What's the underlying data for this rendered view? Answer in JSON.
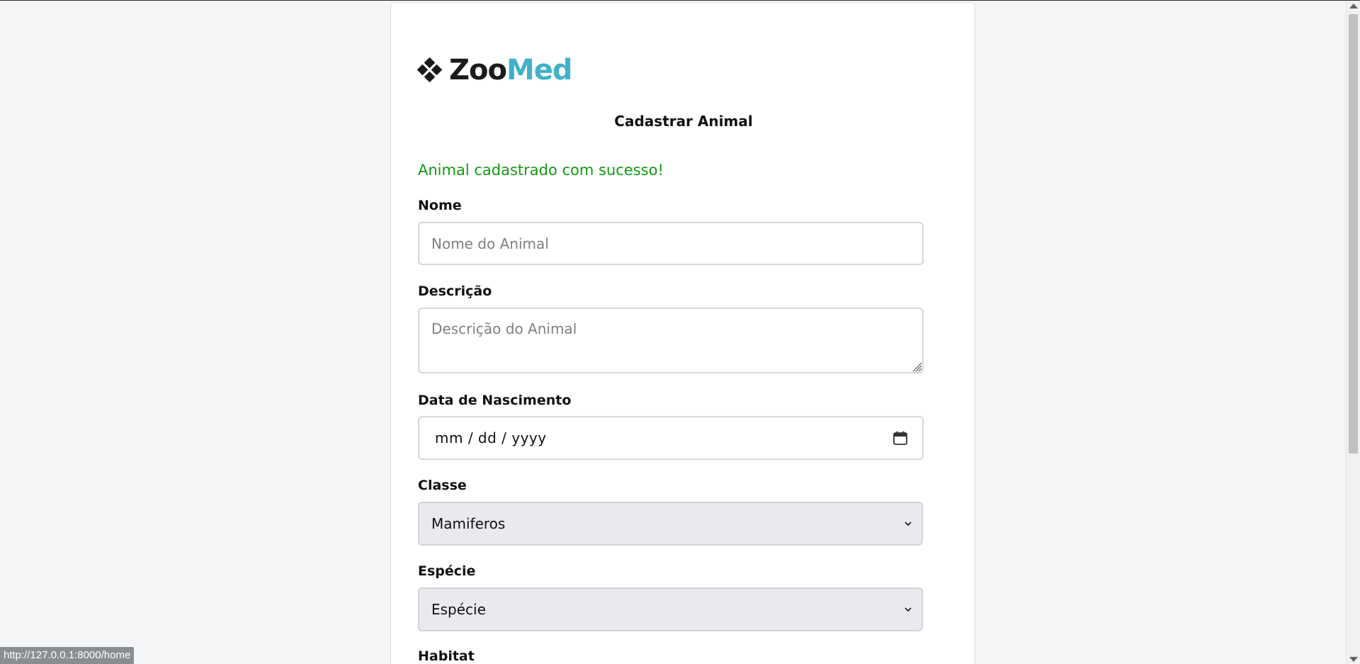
{
  "logo": {
    "part1": "Zoo",
    "part2": "Med"
  },
  "page_title": "Cadastrar Animal",
  "success_message": "Animal cadastrado com sucesso!",
  "form": {
    "nome": {
      "label": "Nome",
      "placeholder": "Nome do Animal",
      "value": ""
    },
    "descricao": {
      "label": "Descrição",
      "placeholder": "Descrição do Animal",
      "value": ""
    },
    "data_nascimento": {
      "label": "Data de Nascimento",
      "placeholder": "mm / dd / yyyy"
    },
    "classe": {
      "label": "Classe",
      "selected": "Mamiferos"
    },
    "especie": {
      "label": "Espécie",
      "selected": "Espécie"
    },
    "habitat": {
      "label": "Habitat"
    }
  },
  "status_bar_url": "http://127.0.0.1:8000/home",
  "colors": {
    "brand_dark": "#1b1b1b",
    "brand_accent": "#41b0cb",
    "success": "#129a12",
    "page_background": "#f4f5f7",
    "select_background": "#e9e9ee"
  },
  "icons": {
    "logo": "diamond-cluster-icon",
    "date": "calendar-icon",
    "select": "chevron-down-icon",
    "textarea": "resize-grip-icon"
  }
}
